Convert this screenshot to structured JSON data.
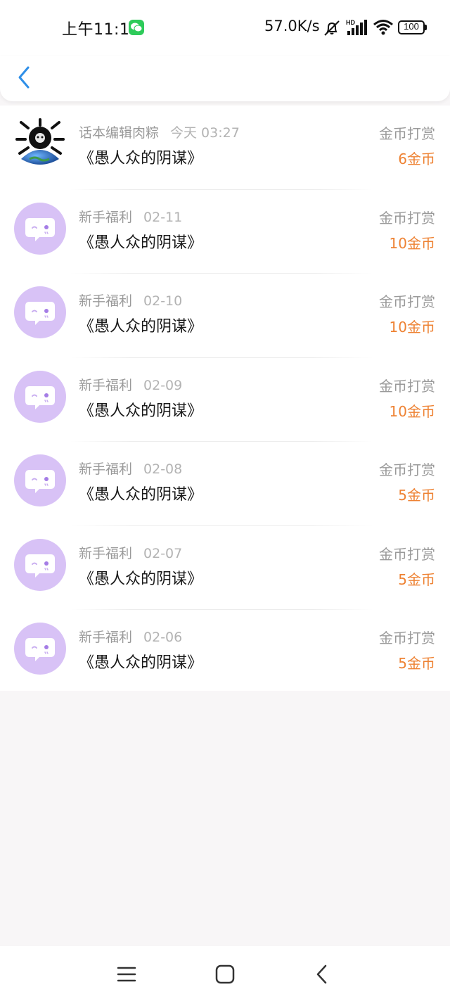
{
  "status_bar": {
    "time": "上午11:12",
    "net_speed": "57.0K/s",
    "battery": "100",
    "icons": [
      "wechat-icon",
      "mute-icon",
      "hd-signal-icon",
      "wifi-icon",
      "battery-icon"
    ]
  },
  "header": {
    "back_icon": "chevron-left-icon"
  },
  "records": [
    {
      "sender": "话本编辑肉粽",
      "time": "今天 03:27",
      "book": "《愚人众的阴谋》",
      "type": "金币打赏",
      "amount": "6金币",
      "avatar": "custom-avatar"
    },
    {
      "sender": "新手福利",
      "time": "02-11",
      "book": "《愚人众的阴谋》",
      "type": "金币打赏",
      "amount": "10金币",
      "avatar": "chat-bubble-icon"
    },
    {
      "sender": "新手福利",
      "time": "02-10",
      "book": "《愚人众的阴谋》",
      "type": "金币打赏",
      "amount": "10金币",
      "avatar": "chat-bubble-icon"
    },
    {
      "sender": "新手福利",
      "time": "02-09",
      "book": "《愚人众的阴谋》",
      "type": "金币打赏",
      "amount": "10金币",
      "avatar": "chat-bubble-icon"
    },
    {
      "sender": "新手福利",
      "time": "02-08",
      "book": "《愚人众的阴谋》",
      "type": "金币打赏",
      "amount": "5金币",
      "avatar": "chat-bubble-icon"
    },
    {
      "sender": "新手福利",
      "time": "02-07",
      "book": "《愚人众的阴谋》",
      "type": "金币打赏",
      "amount": "5金币",
      "avatar": "chat-bubble-icon"
    },
    {
      "sender": "新手福利",
      "time": "02-06",
      "book": "《愚人众的阴谋》",
      "type": "金币打赏",
      "amount": "5金币",
      "avatar": "chat-bubble-icon"
    }
  ],
  "nav_bar": {
    "icons": [
      "menu-icon",
      "home-square-icon",
      "back-triangle-icon"
    ]
  },
  "colors": {
    "amount": "#ee8233",
    "avatar_bg": "#d8c2f6",
    "back_arrow": "#2f8fe8"
  }
}
